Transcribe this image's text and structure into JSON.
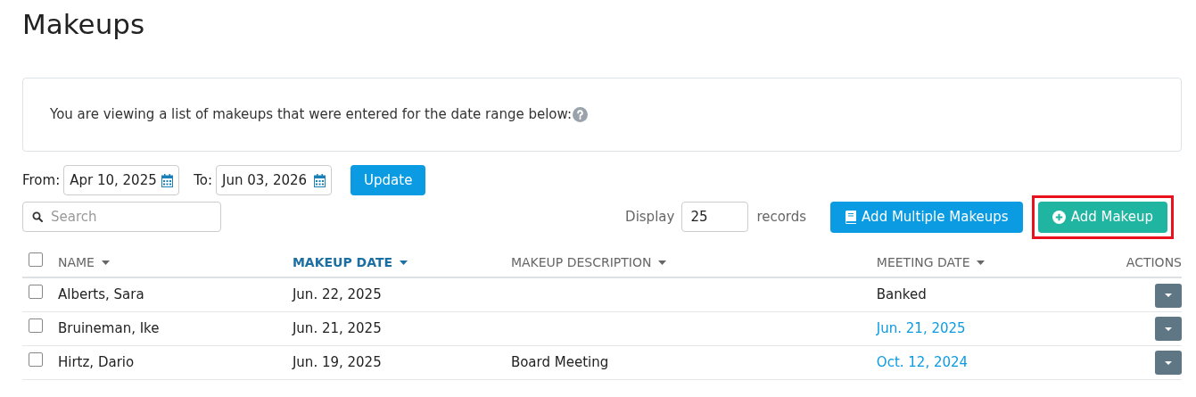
{
  "page_title": "Makeups",
  "info": {
    "text": "You are viewing a list of makeups that were entered for the date range below:"
  },
  "filters": {
    "from_label": "From:",
    "from_value": "Apr 10, 2025",
    "to_label": "To:",
    "to_value": "Jun 03, 2026",
    "update_button": "Update"
  },
  "search": {
    "placeholder": "Search"
  },
  "display": {
    "label": "Display",
    "value": "25",
    "suffix": "records"
  },
  "buttons": [
    {
      "label": "Add Multiple Makeups",
      "kind": "book",
      "highlighted": false
    },
    {
      "label": "Add Makeup",
      "kind": "plus",
      "highlighted": true
    }
  ],
  "table": {
    "select_all": {
      "checked": false
    },
    "columns": [
      {
        "label": "NAME",
        "sortable": true,
        "selected": false
      },
      {
        "label": "MAKEUP DATE",
        "sortable": true,
        "selected": true
      },
      {
        "label": "MAKEUP DESCRIPTION",
        "sortable": true,
        "selected": false
      },
      {
        "label": "MEETING DATE",
        "sortable": true,
        "selected": false
      },
      {
        "label": "ACTIONS",
        "sortable": false,
        "selected": false
      }
    ],
    "rows": [
      {
        "checked": false,
        "name": "Alberts, Sara",
        "makeup_date": "Jun. 22, 2025",
        "meeting_date": {
          "text": "Banked",
          "kind": "text"
        }
      },
      {
        "checked": false,
        "name": "Bruineman, Ike",
        "makeup_date": "Jun. 21, 2025",
        "meeting_date": {
          "text": "Jun. 21, 2025",
          "kind": "link"
        }
      },
      {
        "checked": false,
        "name": "Hirtz, Dario",
        "makeup_date": "Jun. 19, 2025",
        "description": "Board Meeting",
        "meeting_date": {
          "text": "Oct. 12, 2024",
          "kind": "link"
        }
      }
    ]
  }
}
